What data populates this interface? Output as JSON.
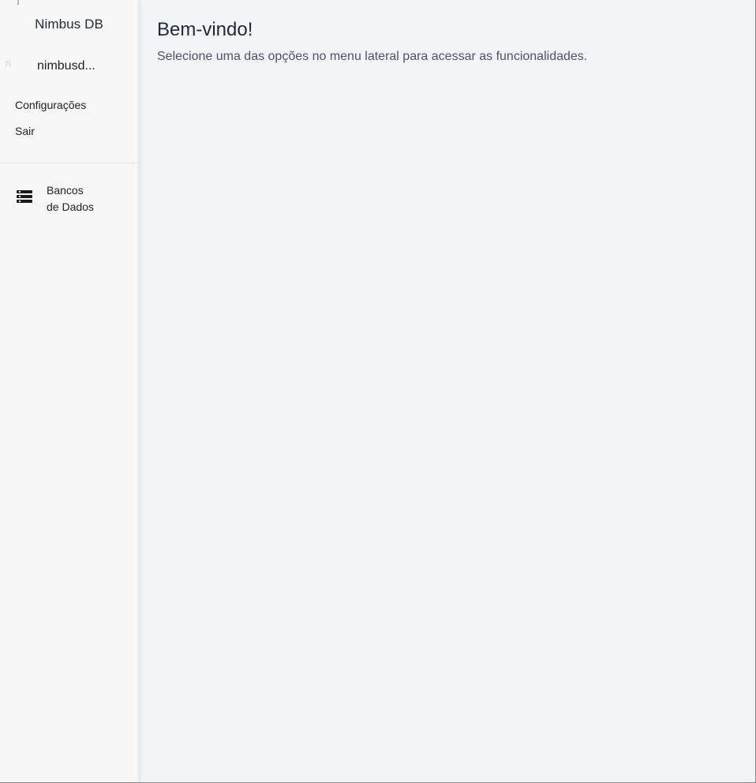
{
  "sidebar": {
    "brand": "Nimbus DB",
    "corner_mark": "ĵ",
    "avatar_initial": "n",
    "username": "nimbusd...",
    "menu": {
      "settings_label": "Configurações",
      "logout_label": "Sair"
    },
    "nav": [
      {
        "icon": "database-icon",
        "label_line1": "Bancos",
        "label_line2": "de Dados"
      }
    ]
  },
  "main": {
    "title": "Bem-vindo!",
    "subtitle": "Selecione uma das opções no menu lateral para acessar as funcionalidades."
  }
}
